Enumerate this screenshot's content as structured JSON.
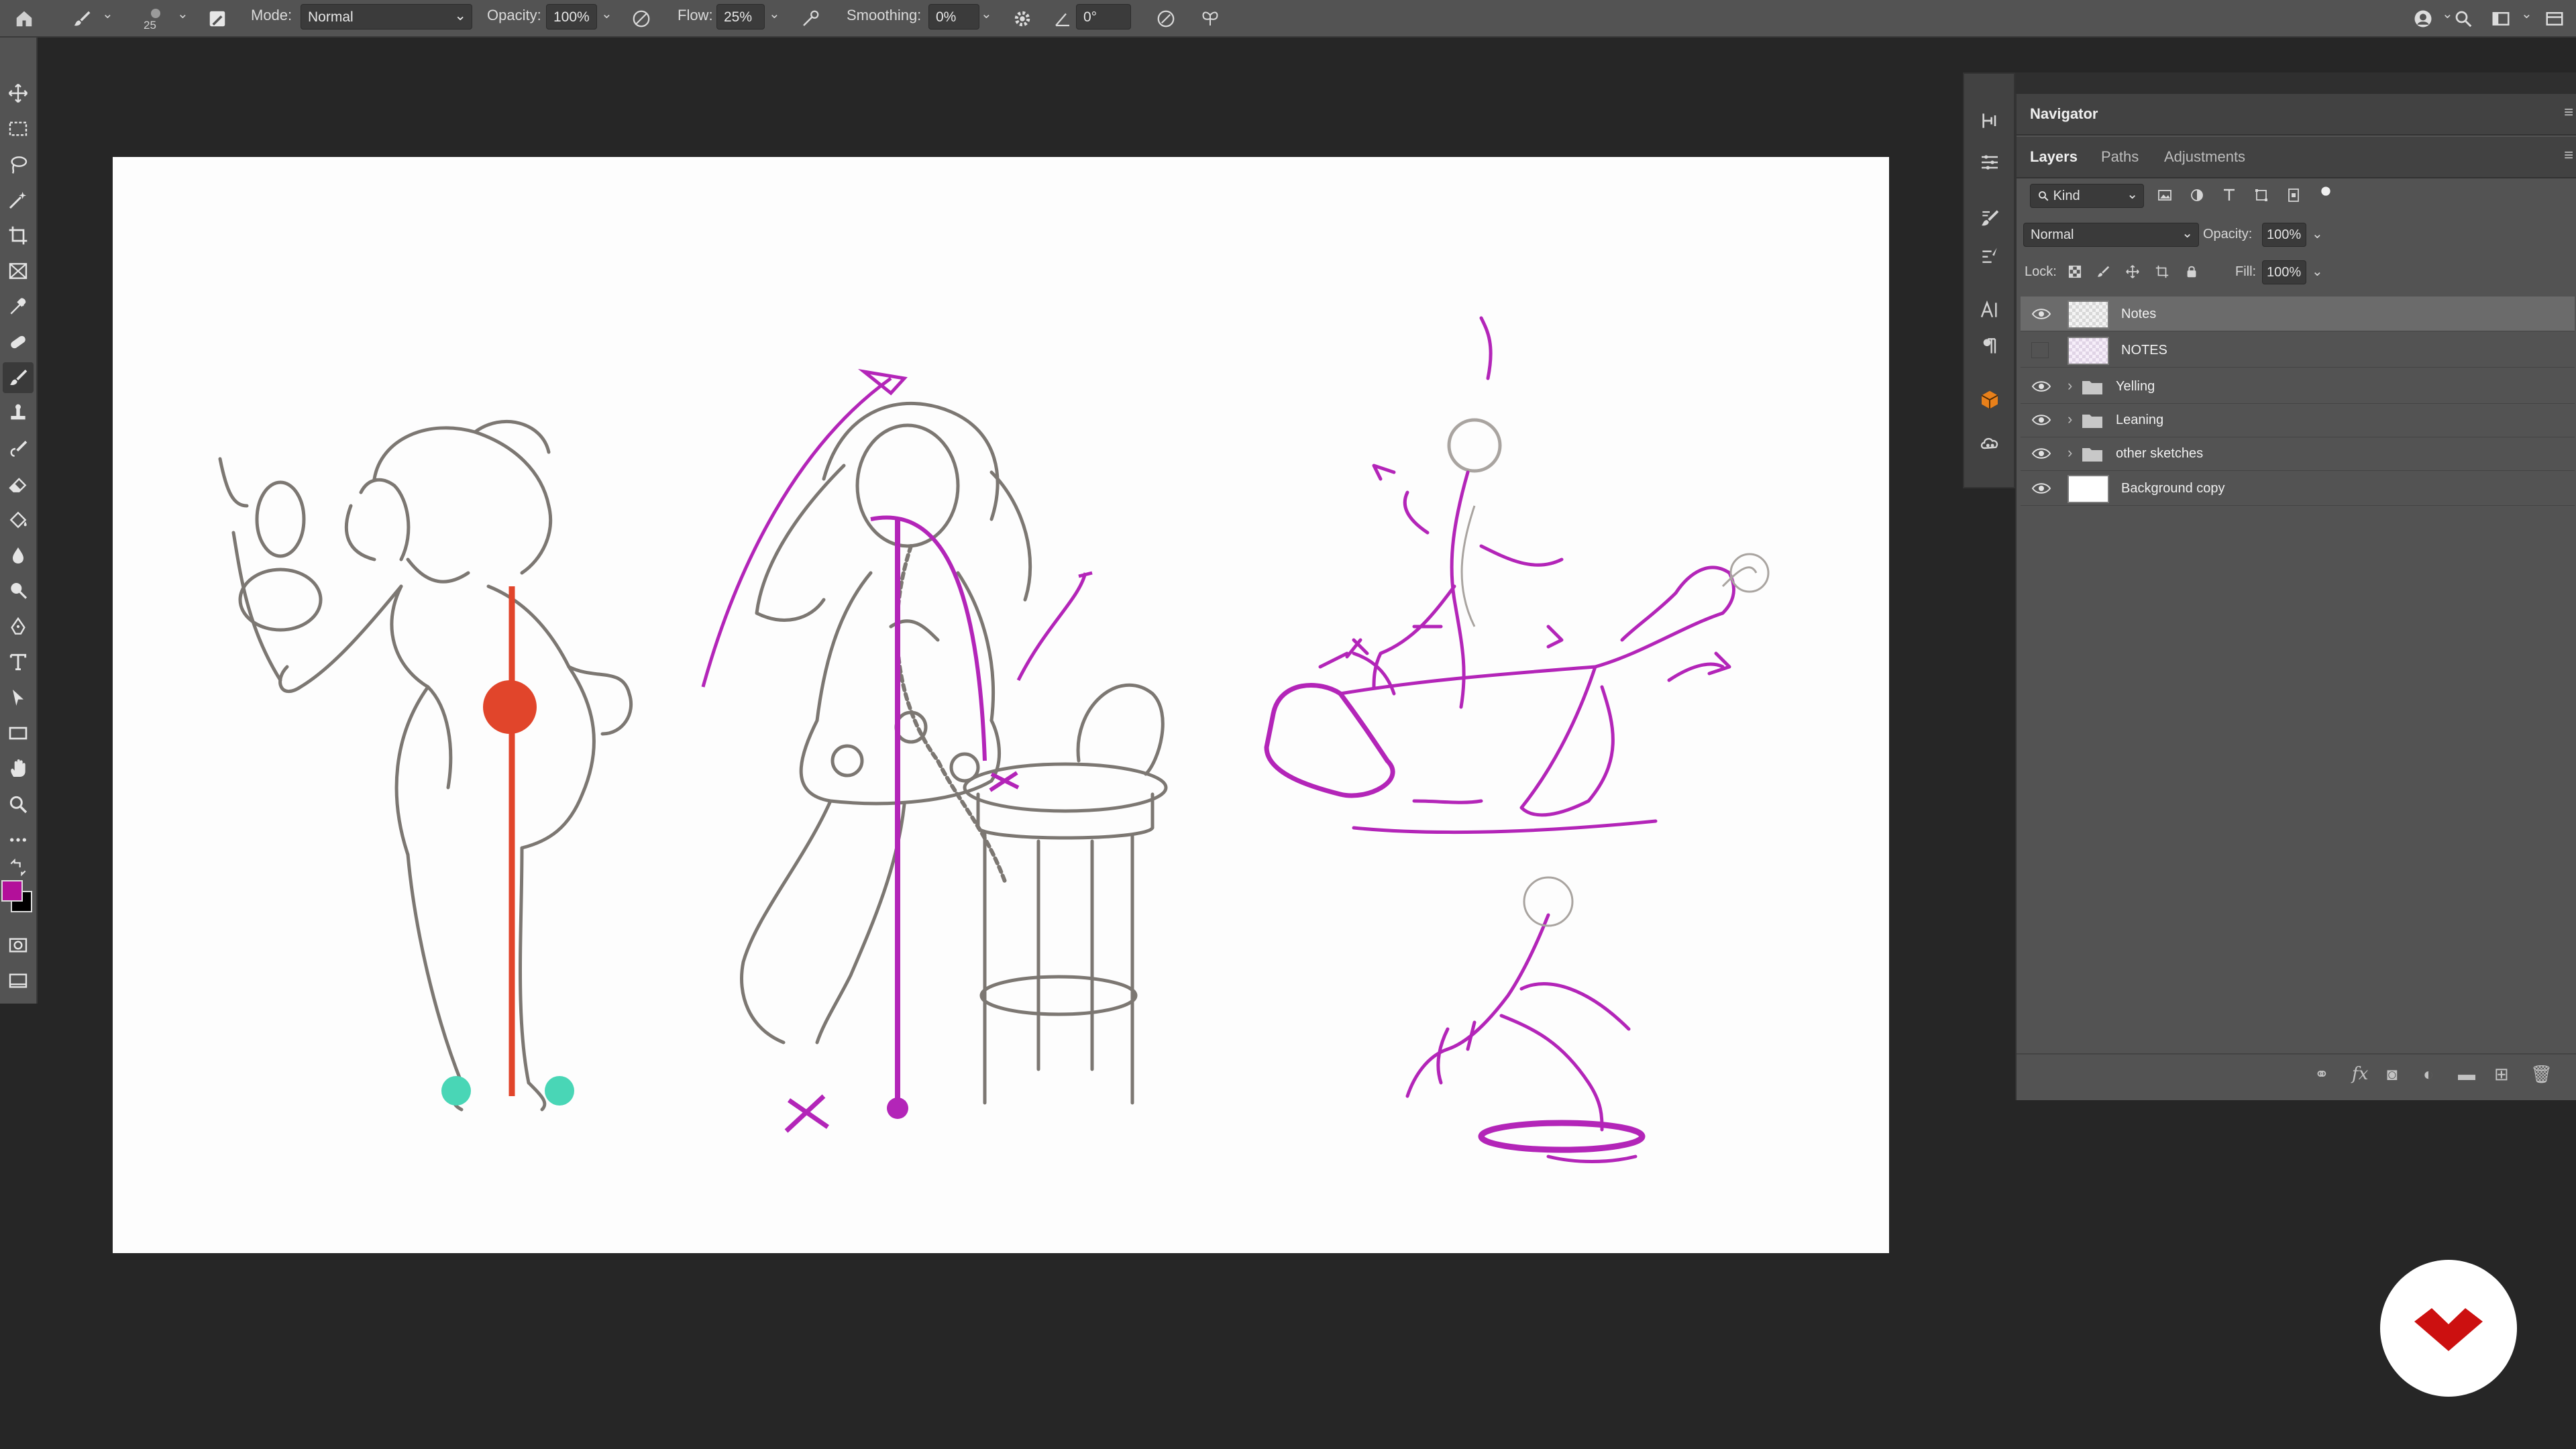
{
  "options_bar": {
    "home_icon": "home-icon",
    "brush_size": "25",
    "mode_label": "Mode:",
    "mode_value": "Normal",
    "opacity_label": "Opacity:",
    "opacity_value": "100%",
    "flow_label": "Flow:",
    "flow_value": "25%",
    "smoothing_label": "Smoothing:",
    "smoothing_value": "0%",
    "angle_value": "0°"
  },
  "colors": {
    "foreground": "#b3109a",
    "background": "#000000",
    "accent_purple": "#b325b8",
    "accent_red": "#e1452b",
    "accent_teal": "#49d6b6",
    "logo_red": "#cc1010"
  },
  "navigator": {
    "title": "Navigator"
  },
  "layers_panel": {
    "tabs": [
      "Layers",
      "Paths",
      "Adjustments"
    ],
    "filter_kind": "Kind",
    "blend_mode": "Normal",
    "opacity_label": "Opacity:",
    "opacity_value": "100%",
    "lock_label": "Lock:",
    "fill_label": "Fill:",
    "fill_value": "100%",
    "layers": [
      {
        "name": "Notes",
        "visible": true,
        "type": "layer",
        "selected": true
      },
      {
        "name": "NOTES",
        "visible": false,
        "type": "layer",
        "selected": false
      },
      {
        "name": "Yelling",
        "visible": true,
        "type": "group",
        "selected": false
      },
      {
        "name": "Leaning",
        "visible": true,
        "type": "group",
        "selected": false
      },
      {
        "name": "other sketches",
        "visible": true,
        "type": "group",
        "selected": false
      },
      {
        "name": "Background copy",
        "visible": true,
        "type": "layer",
        "selected": false
      }
    ]
  }
}
